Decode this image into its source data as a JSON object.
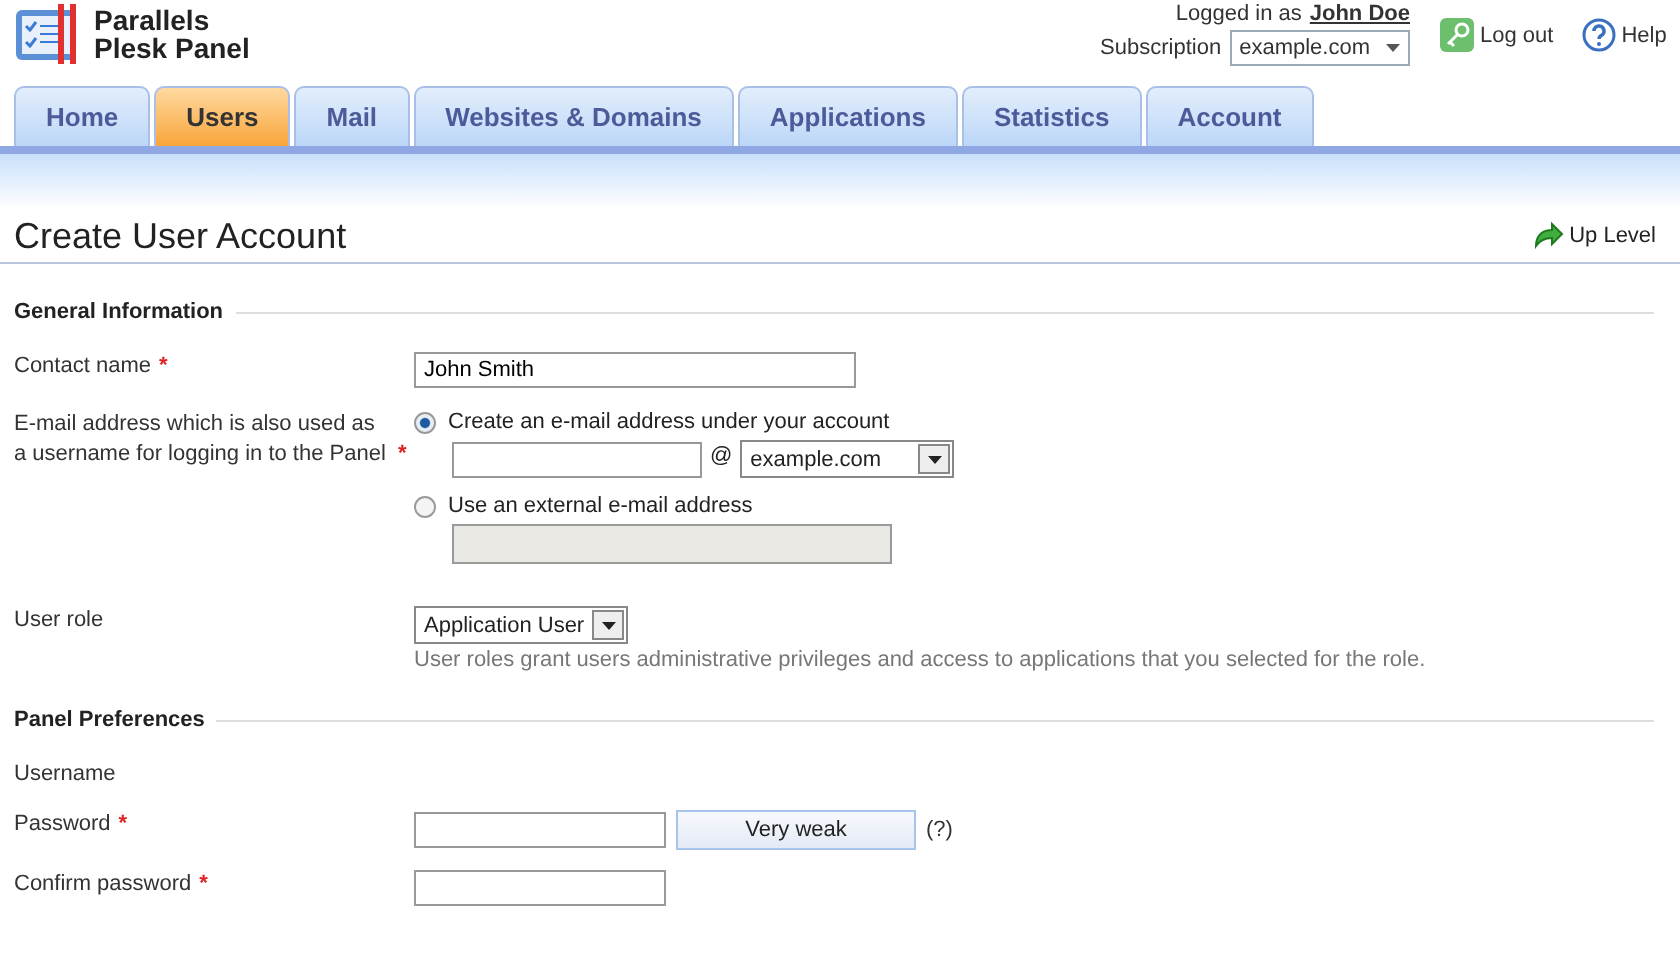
{
  "logo": {
    "line1": "Parallels",
    "line2": "Plesk Panel"
  },
  "account": {
    "logged_in_label": "Logged in as",
    "user": "John Doe",
    "subscription_label": "Subscription",
    "subscription": "example.com"
  },
  "top_links": [
    {
      "kind": "logout",
      "label": "Log out"
    },
    {
      "kind": "help",
      "label": "Help"
    }
  ],
  "tabs": [
    {
      "label": "Home",
      "selected": false
    },
    {
      "label": "Users",
      "selected": true
    },
    {
      "label": "Mail",
      "selected": false
    },
    {
      "label": "Websites & Domains",
      "selected": false
    },
    {
      "label": "Applications",
      "selected": false
    },
    {
      "label": "Statistics",
      "selected": false
    },
    {
      "label": "Account",
      "selected": false
    }
  ],
  "page_title": "Create User Account",
  "up_level": "Up Level",
  "sections": [
    {
      "title": "General Information",
      "rows": [
        {
          "kind": "text",
          "label": "Contact name",
          "required_mark": "*",
          "value": "John Smith"
        },
        {
          "kind": "email",
          "label": "E-mail address which is also used as a username for logging in to the Panel",
          "required_mark": "*",
          "options": [
            {
              "label": "Create an e-mail address under your account",
              "selected": true
            },
            {
              "label": "Use an external e-mail address",
              "selected": false
            }
          ],
          "at": "@",
          "domain": "example.com"
        },
        {
          "kind": "select",
          "label": "User role",
          "value": "Application User",
          "hint": "User roles grant users administrative privileges and access to applications that you selected for the role."
        }
      ]
    },
    {
      "title": "Panel Preferences",
      "rows": [
        {
          "kind": "plain",
          "label": "Username"
        },
        {
          "kind": "password",
          "label": "Password",
          "required_mark": "*",
          "strength": "Very weak",
          "help": "(?)"
        },
        {
          "kind": "text",
          "label": "Confirm password",
          "required_mark": "*"
        }
      ]
    }
  ]
}
